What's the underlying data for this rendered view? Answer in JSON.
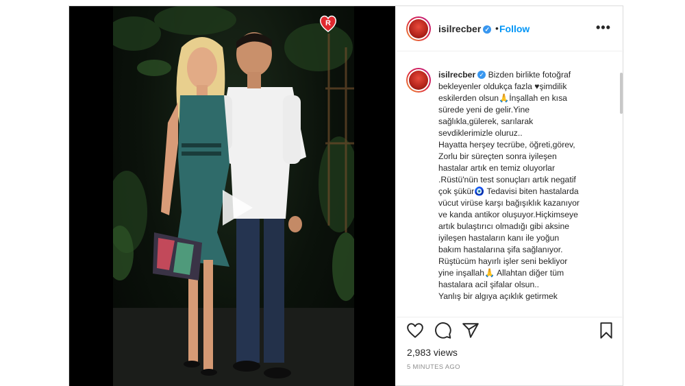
{
  "post": {
    "username": "isilrecber",
    "follow_label": "Follow",
    "more_label": "•••",
    "dot": "•",
    "badge_letter": "R",
    "caption_lines": [
      "Bizden birlikte fotoğraf",
      "bekleyenler oldukça fazla ♥şimdilik",
      "eskilerden olsun🙏İnşallah en kısa",
      "sürede yeni de gelir.Yine",
      "sağlıkla,gülerek, sarılarak",
      "sevdiklerimizle oluruz..",
      "Hayatta herşey tecrübe, öğreti,görev,",
      "Zorlu bir süreçten sonra iyileşen",
      "hastalar artık en temiz oluyorlar",
      ".Rüstü'nün test sonuçları artık negatif",
      "çok şükür🧿 Tedavisi biten hastalarda",
      "vücut virüse karşı bağışıklık kazanıyor",
      "ve kanda antikor oluşuyor.Hiçkimseye",
      "artık bulaştırıcı olmadığı gibi aksine",
      "iyileşen hastaların kanı ile yoğun",
      "bakım hastalarına şifa sağlanıyor.",
      "Rüştücüm hayırlı işler seni bekliyor",
      "yine inşallah🙏 Allahtan diğer tüm",
      "hastalara acil şifalar olsun..",
      "Yanlış bir algıya açıklık getirmek"
    ],
    "views": "2,983 views",
    "time_ago": "5 MINUTES AGO"
  },
  "icons": {
    "heart": "heart-icon",
    "comment": "comment-icon",
    "share": "share-icon",
    "save": "bookmark-icon",
    "play": "play-icon",
    "verified": "verified-badge-icon"
  },
  "colors": {
    "follow": "#0095f6",
    "verified": "#3897f0",
    "badge": "#e0282e"
  }
}
